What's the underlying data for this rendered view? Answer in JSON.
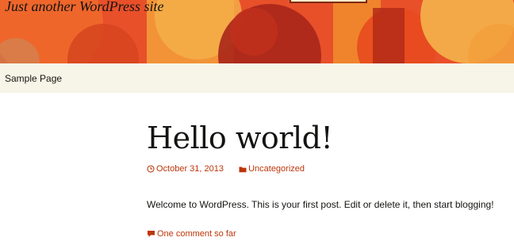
{
  "site": {
    "description": "Just another WordPress site",
    "colors": {
      "header_base": "#e8502a",
      "nav_background": "#f7f5e7",
      "accent": "#bc360a",
      "text": "#141412"
    }
  },
  "nav": {
    "items": [
      {
        "label": "Sample Page"
      }
    ]
  },
  "post": {
    "title": "Hello world!",
    "date": "October 31, 2013",
    "date_icon": "clock-icon",
    "category": "Uncategorized",
    "category_icon": "folder-icon",
    "content": "Welcome to WordPress. This is your first post. Edit or delete it, then start blogging!",
    "comments_label": "One comment so far",
    "comments_icon": "comment-icon"
  }
}
